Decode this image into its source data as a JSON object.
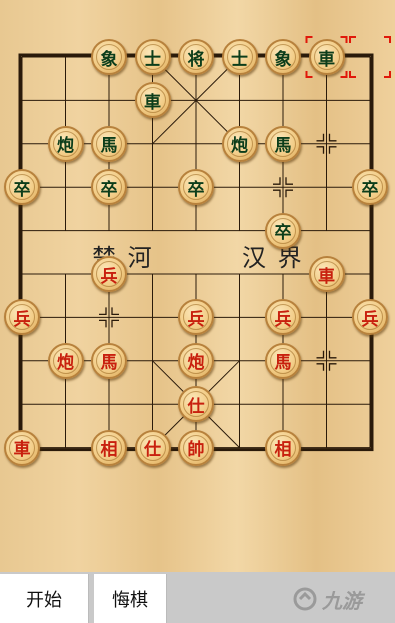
{
  "board": {
    "river_left": "楚 河",
    "river_right": "汉 界"
  },
  "pieces": [
    {
      "id": "b-xiang-1",
      "side": "black",
      "label": "象",
      "c": 2,
      "r": 0
    },
    {
      "id": "b-shi-1",
      "side": "black",
      "label": "士",
      "c": 3,
      "r": 0
    },
    {
      "id": "b-jiang",
      "side": "black",
      "label": "将",
      "c": 4,
      "r": 0
    },
    {
      "id": "b-shi-2",
      "side": "black",
      "label": "士",
      "c": 5,
      "r": 0
    },
    {
      "id": "b-xiang-2",
      "side": "black",
      "label": "象",
      "c": 6,
      "r": 0
    },
    {
      "id": "b-che-1",
      "side": "black",
      "label": "車",
      "c": 7,
      "r": 0
    },
    {
      "id": "b-che-2",
      "side": "black",
      "label": "車",
      "c": 3,
      "r": 1
    },
    {
      "id": "b-pao-1",
      "side": "black",
      "label": "炮",
      "c": 1,
      "r": 2
    },
    {
      "id": "b-ma-1",
      "side": "black",
      "label": "馬",
      "c": 2,
      "r": 2
    },
    {
      "id": "b-pao-2",
      "side": "black",
      "label": "炮",
      "c": 5,
      "r": 2
    },
    {
      "id": "b-ma-2",
      "side": "black",
      "label": "馬",
      "c": 6,
      "r": 2
    },
    {
      "id": "b-zu-1",
      "side": "black",
      "label": "卒",
      "c": 0,
      "r": 3
    },
    {
      "id": "b-zu-2",
      "side": "black",
      "label": "卒",
      "c": 2,
      "r": 3
    },
    {
      "id": "b-zu-3",
      "side": "black",
      "label": "卒",
      "c": 4,
      "r": 3
    },
    {
      "id": "b-zu-4",
      "side": "black",
      "label": "卒",
      "c": 8,
      "r": 3
    },
    {
      "id": "b-zu-5",
      "side": "black",
      "label": "卒",
      "c": 6,
      "r": 4
    },
    {
      "id": "r-bing-1",
      "side": "red",
      "label": "兵",
      "c": 2,
      "r": 5
    },
    {
      "id": "r-che-1",
      "side": "red",
      "label": "車",
      "c": 7,
      "r": 5
    },
    {
      "id": "r-bing-2",
      "side": "red",
      "label": "兵",
      "c": 0,
      "r": 6
    },
    {
      "id": "r-bing-3",
      "side": "red",
      "label": "兵",
      "c": 4,
      "r": 6
    },
    {
      "id": "r-bing-4",
      "side": "red",
      "label": "兵",
      "c": 6,
      "r": 6
    },
    {
      "id": "r-bing-5",
      "side": "red",
      "label": "兵",
      "c": 8,
      "r": 6
    },
    {
      "id": "r-pao-1",
      "side": "red",
      "label": "炮",
      "c": 1,
      "r": 7
    },
    {
      "id": "r-ma-1",
      "side": "red",
      "label": "馬",
      "c": 2,
      "r": 7
    },
    {
      "id": "r-pao-2",
      "side": "red",
      "label": "炮",
      "c": 4,
      "r": 7
    },
    {
      "id": "r-ma-2",
      "side": "red",
      "label": "馬",
      "c": 6,
      "r": 7
    },
    {
      "id": "r-shi-1",
      "side": "red",
      "label": "仕",
      "c": 4,
      "r": 8
    },
    {
      "id": "r-che-2",
      "side": "red",
      "label": "車",
      "c": 0,
      "r": 9
    },
    {
      "id": "r-xiang-1",
      "side": "red",
      "label": "相",
      "c": 2,
      "r": 9
    },
    {
      "id": "r-shi-2",
      "side": "red",
      "label": "仕",
      "c": 3,
      "r": 9
    },
    {
      "id": "r-shuai",
      "side": "red",
      "label": "帥",
      "c": 4,
      "r": 9
    },
    {
      "id": "r-xiang-2",
      "side": "red",
      "label": "相",
      "c": 6,
      "r": 9
    }
  ],
  "selection": {
    "from": {
      "c": 7,
      "r": 0
    },
    "to": {
      "c": 8,
      "r": 0
    }
  },
  "toolbar": {
    "start_label": "开始",
    "undo_label": "悔棋"
  },
  "watermark": {
    "text": "九游"
  },
  "colors": {
    "black_piece": "#0c3d1a",
    "red_piece": "#c8200e",
    "selection": "#e0180a",
    "line": "#2a1a0a"
  }
}
